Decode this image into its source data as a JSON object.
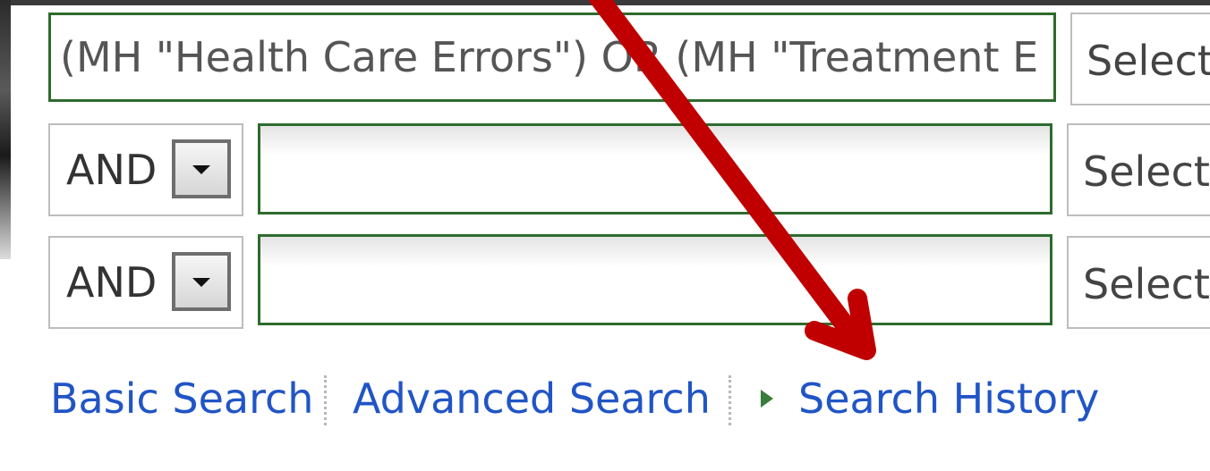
{
  "search_rows": [
    {
      "value": "(MH \"Health Care Errors\") OR (MH \"Treatment E",
      "placeholder": "",
      "field_select": "Select"
    },
    {
      "operator": "AND",
      "value": "",
      "placeholder": "",
      "field_select": "Select"
    },
    {
      "operator": "AND",
      "value": "",
      "placeholder": "",
      "field_select": "Select"
    }
  ],
  "links": {
    "basic_search": "Basic Search",
    "advanced_search": "Advanced Search",
    "search_history": "Search History"
  },
  "icons": {
    "dropdown": "chevron-down-icon",
    "history_expand": "play-icon"
  },
  "annotation": {
    "type": "arrow",
    "color": "#c00000",
    "points_to": "Search History"
  },
  "colors": {
    "input_border": "#2e6b2e",
    "link": "#2155c6",
    "arrow": "#c00000"
  }
}
